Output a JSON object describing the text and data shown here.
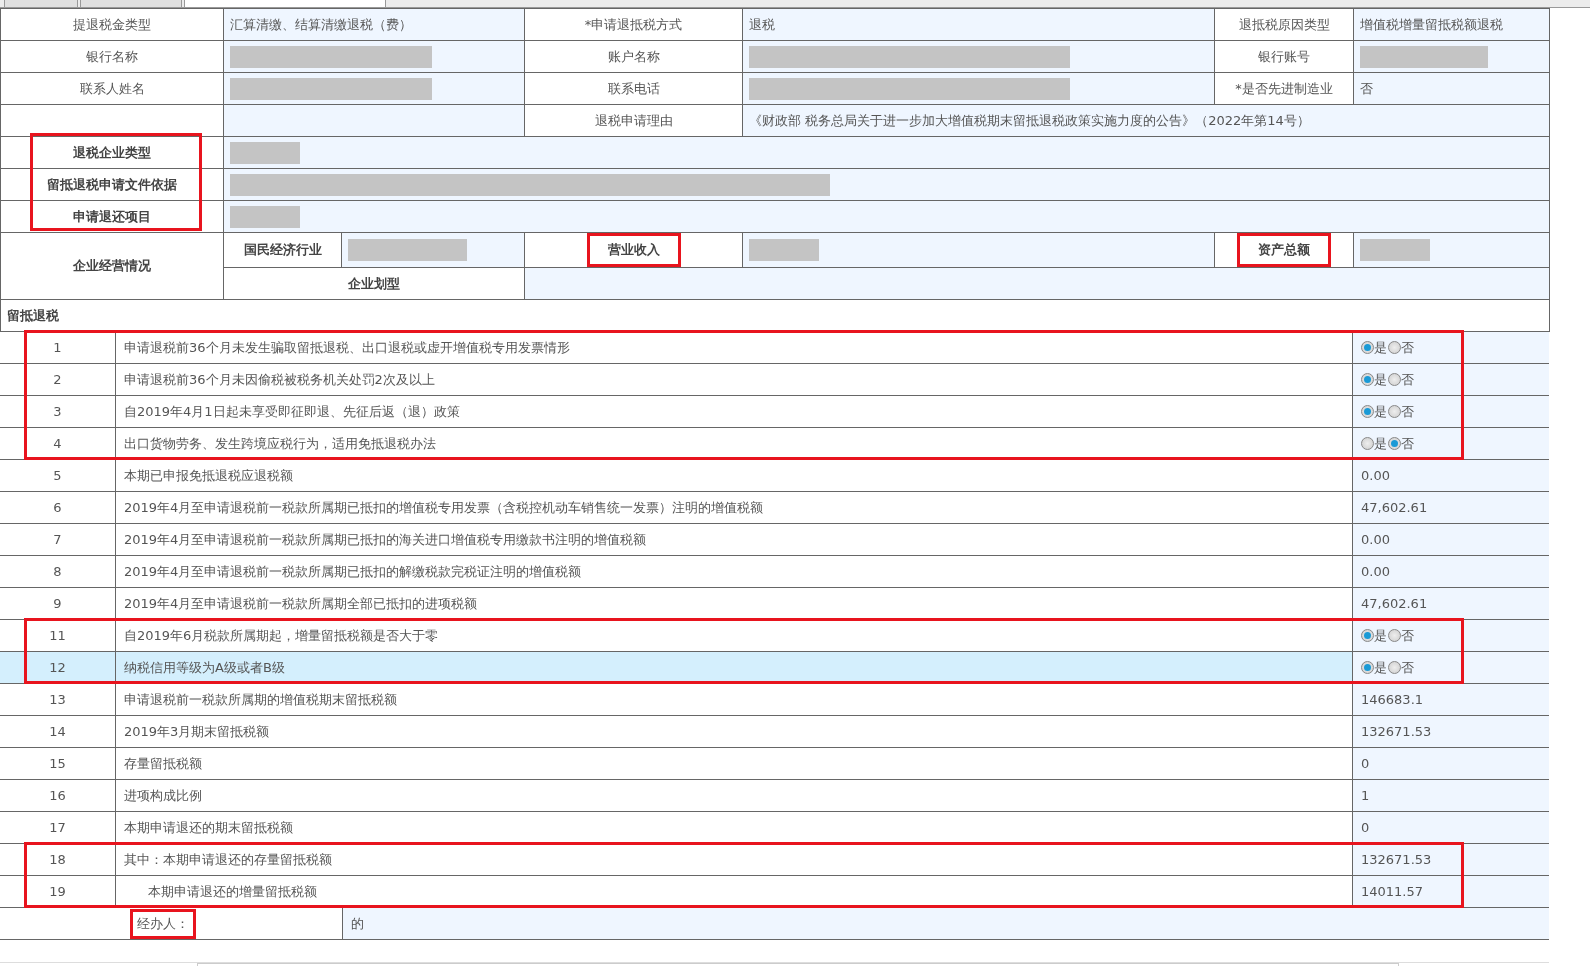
{
  "tabs": [
    {
      "selected": false
    },
    {
      "selected": false
    },
    {
      "selected": true
    }
  ],
  "info_rows": [
    [
      {
        "label": "提退税金类型"
      },
      {
        "value": "汇算清缴、结算清缴退税（费）"
      },
      {
        "label": "*申请退抵税方式"
      },
      {
        "value": "退税"
      },
      {
        "label": "退抵税原因类型"
      },
      {
        "value": "增值税增量留抵税额退税"
      }
    ],
    [
      {
        "label": "银行名称"
      },
      {
        "redacted": true
      },
      {
        "label": "账户名称"
      },
      {
        "redacted": true
      },
      {
        "label": "银行账号"
      },
      {
        "redacted": true
      }
    ],
    [
      {
        "label": "联系人姓名"
      },
      {
        "redacted": true
      },
      {
        "label": "联系电话"
      },
      {
        "redacted": true
      },
      {
        "label": "*是否先进制造业"
      },
      {
        "value": "否"
      }
    ]
  ],
  "refund_reason": {
    "label": "退税申请理由",
    "value": "《财政部 税务总局关于进一步加大增值税期末留抵退税政策实施力度的公告》（2022年第14号）"
  },
  "enterprise_rows": [
    {
      "label": "退税企业类型",
      "highlighted": true,
      "redacted": true
    },
    {
      "label": "留抵退税申请文件依据",
      "highlighted": true,
      "redacted": true
    },
    {
      "label": "申请退还项目",
      "highlighted": true,
      "redacted": true
    }
  ],
  "operations": {
    "label": "企业经营情况",
    "industry": {
      "label": "国民经济行业",
      "highlighted": false,
      "redacted": true
    },
    "revenue": {
      "label": "营业收入",
      "highlighted": true,
      "redacted": true
    },
    "assets": {
      "label": "资产总额",
      "highlighted": true,
      "redacted": true
    },
    "size": {
      "label": "企业划型"
    }
  },
  "section_title": "留抵退税",
  "items": [
    {
      "no": "1",
      "text": "申请退税前36个月未发生骗取留抵退税、出口退税或虚开增值税专用发票情形",
      "kind": "radio",
      "options": [
        {
          "label": "是",
          "selected": true
        },
        {
          "label": "否",
          "selected": false
        }
      ],
      "highlighted": true,
      "selected": false
    },
    {
      "no": "2",
      "text": "申请退税前36个月未因偷税被税务机关处罚2次及以上",
      "kind": "radio",
      "options": [
        {
          "label": "是",
          "selected": true
        },
        {
          "label": "否",
          "selected": false
        }
      ],
      "highlighted": true,
      "selected": false
    },
    {
      "no": "3",
      "text": "自2019年4月1日起未享受即征即退、先征后返（退）政策",
      "kind": "radio",
      "options": [
        {
          "label": "是",
          "selected": true
        },
        {
          "label": "否",
          "selected": false
        }
      ],
      "highlighted": true,
      "selected": false
    },
    {
      "no": "4",
      "text": "出口货物劳务、发生跨境应税行为，适用免抵退税办法",
      "kind": "radio",
      "options": [
        {
          "label": "是",
          "selected": false
        },
        {
          "label": "否",
          "selected": true
        }
      ],
      "highlighted": true,
      "selected": false
    },
    {
      "no": "5",
      "text": "本期已申报免抵退税应退税额",
      "kind": "value",
      "value": "0.00",
      "highlighted": false,
      "selected": false
    },
    {
      "no": "6",
      "text": "2019年4月至申请退税前一税款所属期已抵扣的增值税专用发票（含税控机动车销售统一发票）注明的增值税额",
      "kind": "value",
      "value": "47,602.61",
      "highlighted": false,
      "selected": false
    },
    {
      "no": "7",
      "text": "2019年4月至申请退税前一税款所属期已抵扣的海关进口增值税专用缴款书注明的增值税额",
      "kind": "value",
      "value": "0.00",
      "highlighted": false,
      "selected": false
    },
    {
      "no": "8",
      "text": "2019年4月至申请退税前一税款所属期已抵扣的解缴税款完税证注明的增值税额",
      "kind": "value",
      "value": "0.00",
      "highlighted": false,
      "selected": false
    },
    {
      "no": "9",
      "text": "2019年4月至申请退税前一税款所属期全部已抵扣的进项税额",
      "kind": "value",
      "value": "47,602.61",
      "highlighted": false,
      "selected": false
    },
    {
      "no": "11",
      "text": "自2019年6月税款所属期起，增量留抵税额是否大于零",
      "kind": "radio",
      "options": [
        {
          "label": "是",
          "selected": true
        },
        {
          "label": "否",
          "selected": false
        }
      ],
      "highlighted": true,
      "selected": false
    },
    {
      "no": "12",
      "text": "纳税信用等级为A级或者B级",
      "kind": "radio",
      "options": [
        {
          "label": "是",
          "selected": true
        },
        {
          "label": "否",
          "selected": false
        }
      ],
      "highlighted": true,
      "selected": true
    },
    {
      "no": "13",
      "text": "申请退税前一税款所属期的增值税期末留抵税额",
      "kind": "value",
      "value": "146683.1",
      "highlighted": false,
      "selected": false
    },
    {
      "no": "14",
      "text": "2019年3月期末留抵税额",
      "kind": "value",
      "value": "132671.53",
      "highlighted": false,
      "selected": false
    },
    {
      "no": "15",
      "text": "存量留抵税额",
      "kind": "value",
      "value": "0",
      "highlighted": false,
      "selected": false
    },
    {
      "no": "16",
      "text": "进项构成比例",
      "kind": "value",
      "value": "1",
      "highlighted": false,
      "selected": false
    },
    {
      "no": "17",
      "text": "本期申请退还的期末留抵税额",
      "kind": "value",
      "value": "0",
      "highlighted": false,
      "selected": false
    },
    {
      "no": "18",
      "text": "其中：本期申请退还的存量留抵税额",
      "kind": "value",
      "value": "132671.53",
      "highlighted": true,
      "selected": false
    },
    {
      "no": "19",
      "text": "本期申请退还的增量留抵税额",
      "kind": "value",
      "value": "14011.57",
      "highlighted": true,
      "selected": false,
      "indented": true
    }
  ],
  "footer": {
    "handler_label": "经办人：",
    "handler_highlighted": true,
    "value": "的"
  }
}
